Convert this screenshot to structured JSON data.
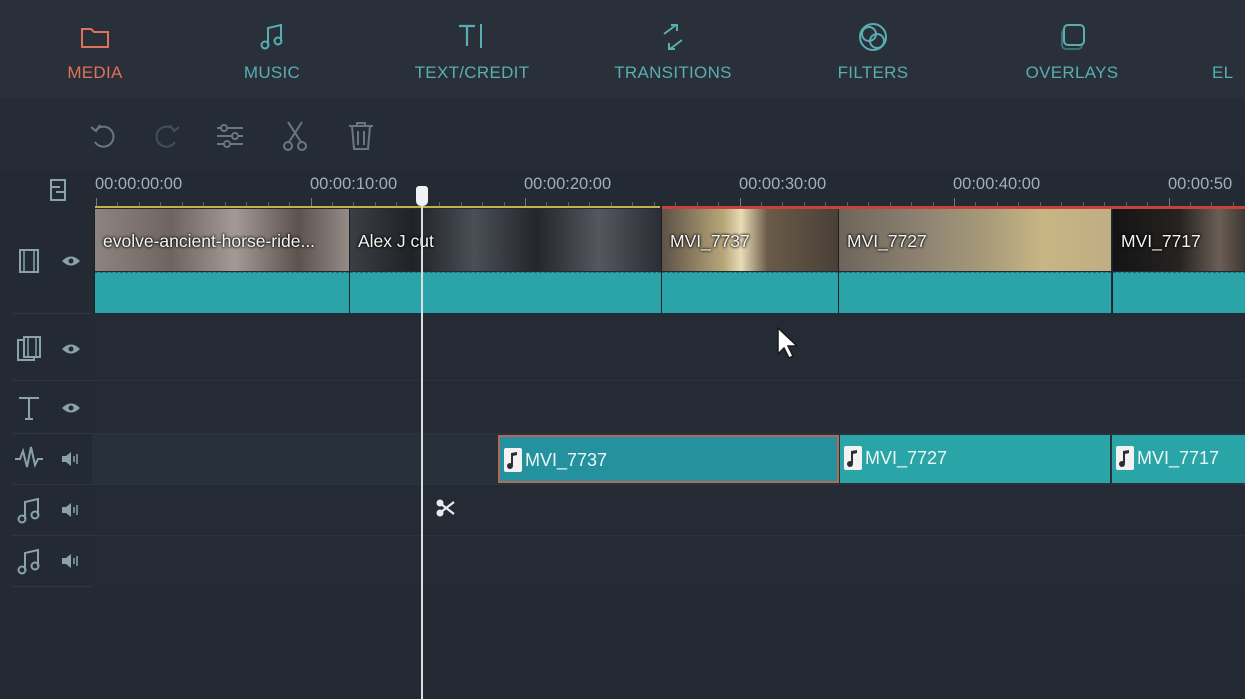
{
  "nav": {
    "tabs": [
      {
        "label": "MEDIA",
        "icon": "folder-icon"
      },
      {
        "label": "MUSIC",
        "icon": "music-note-icon"
      },
      {
        "label": "TEXT/CREDIT",
        "icon": "text-cursor-icon"
      },
      {
        "label": "TRANSITIONS",
        "icon": "transition-arrows-icon"
      },
      {
        "label": "FILTERS",
        "icon": "overlapping-circles-icon"
      },
      {
        "label": "OVERLAYS",
        "icon": "stacked-squares-icon"
      },
      {
        "label": "EL",
        "icon": "elements-icon"
      }
    ],
    "active_index": 0,
    "active_color": "#e0715a",
    "tab_color": "#58aeb3"
  },
  "toolbar": {
    "tools": [
      "undo-icon",
      "redo-icon",
      "adjust-sliders-icon",
      "scissors-icon",
      "trash-icon"
    ]
  },
  "ruler": {
    "labels": [
      "00:00:00:00",
      "00:00:10:00",
      "00:00:20:00",
      "00:00:30:00",
      "00:00:40:00",
      "00:00:50"
    ]
  },
  "tracks": {
    "video_clips": [
      {
        "name": "evolve-ancient-horse-ride..."
      },
      {
        "name": "Alex J cut"
      },
      {
        "name": "MVI_7737"
      },
      {
        "name": "MVI_7727"
      },
      {
        "name": "MVI_7717"
      }
    ],
    "audio_clips": [
      {
        "name": "MVI_7737",
        "selected": true
      },
      {
        "name": "MVI_7727",
        "selected": false
      },
      {
        "name": "MVI_7717",
        "selected": false
      }
    ],
    "headers": [
      "video-track-icon",
      "pip-track-icon",
      "text-track-icon",
      "audio-wave-track-icon",
      "music-track-icon",
      "music-track-icon"
    ]
  },
  "colors": {
    "clip_teal": "#2ba4a9",
    "render_yellow": "#bfb247",
    "render_red": "#c9423a"
  }
}
